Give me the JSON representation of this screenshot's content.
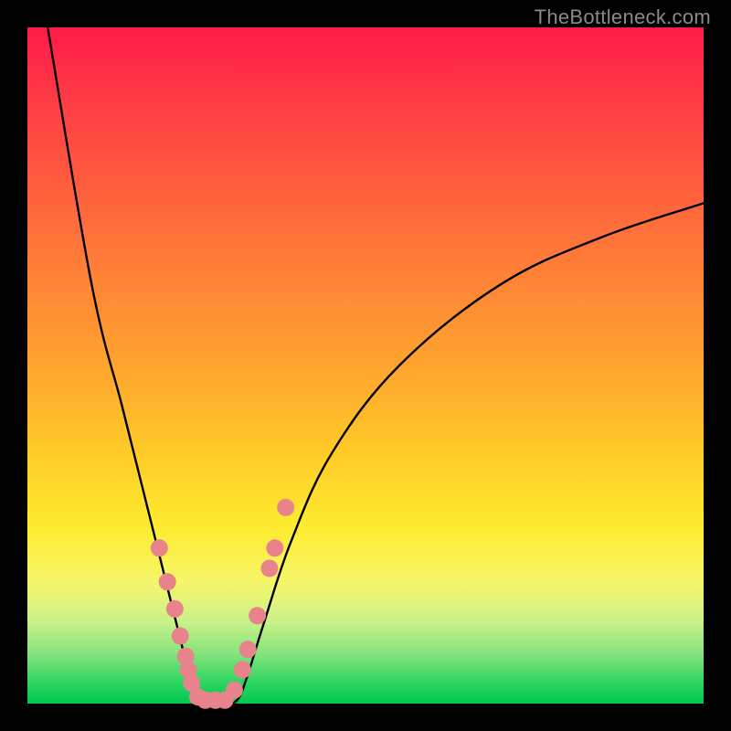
{
  "watermark": "TheBottleneck.com",
  "colors": {
    "curve": "#000000",
    "marker_fill": "#e9838b",
    "marker_stroke": "#d76f78",
    "gradient_stops": [
      "#ff1a49",
      "#ff5a3e",
      "#ffa42f",
      "#fdec30",
      "#7ee27a",
      "#00c94e"
    ]
  },
  "chart_data": {
    "type": "line",
    "title": "",
    "xlabel": "",
    "ylabel": "",
    "xlim": [
      0,
      100
    ],
    "ylim": [
      0,
      100
    ],
    "grid": false,
    "note": "Axis values are estimated from pixel positions; the image shows no numeric ticks or labels.",
    "series": [
      {
        "name": "left-branch",
        "x": [
          3,
          9.5,
          14,
          17.5,
          20,
          22,
          23.5,
          24.7,
          25.5
        ],
        "y": [
          100,
          62,
          44,
          30,
          20,
          12,
          6,
          2,
          0
        ]
      },
      {
        "name": "valley-floor",
        "x": [
          25.5,
          27,
          29,
          31
        ],
        "y": [
          0,
          0,
          0,
          0.5
        ]
      },
      {
        "name": "right-branch",
        "x": [
          31,
          32.5,
          35,
          39,
          45,
          55,
          70,
          85,
          100
        ],
        "y": [
          0.5,
          4,
          12,
          24,
          37,
          50,
          62,
          69,
          74
        ]
      }
    ],
    "markers": {
      "name": "highlighted-points",
      "x": [
        19.5,
        20.7,
        21.8,
        22.6,
        23.4,
        23.8,
        24.3,
        25.2,
        26.3,
        27.8,
        29.2,
        30.6,
        31.8,
        32.6,
        34.0,
        35.8,
        36.6,
        38.2
      ],
      "y": [
        23,
        18,
        14,
        10,
        7,
        5,
        3,
        1,
        0.5,
        0.5,
        0.5,
        2,
        5,
        8,
        13,
        20,
        23,
        29
      ]
    }
  }
}
